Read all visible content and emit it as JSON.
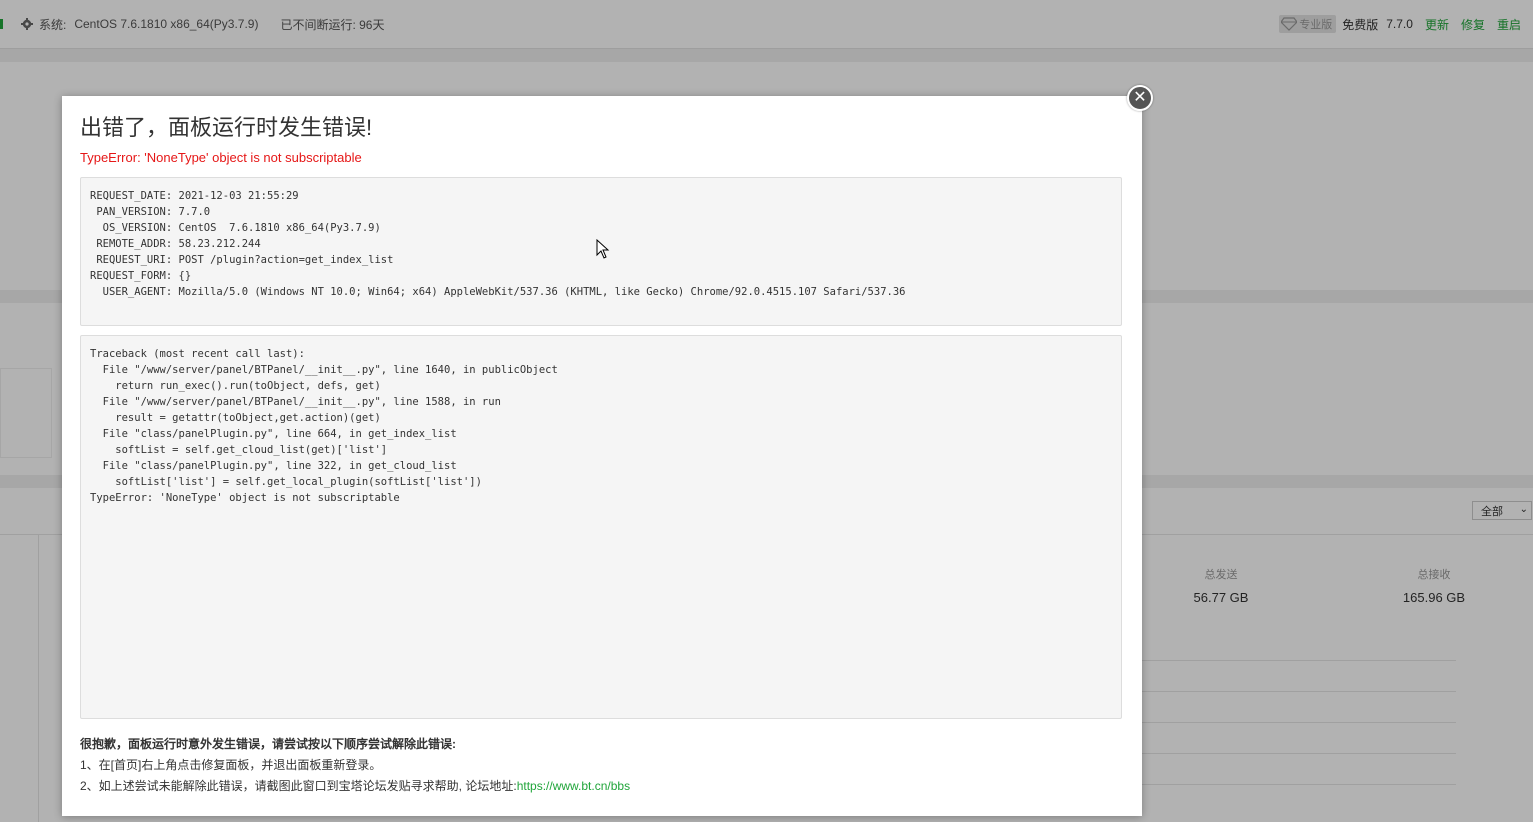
{
  "topbar": {
    "system_label": "系统:",
    "system_value": "CentOS 7.6.1810 x86_64(Py3.7.9)",
    "uptime": "已不间断运行: 96天",
    "pro_badge": "专业版",
    "free_label": "免费版",
    "version": "7.7.0",
    "update_link": "更新",
    "repair_link": "修复",
    "restart_link": "重启"
  },
  "background": {
    "filter_select": "全部",
    "stats": [
      {
        "label": "总发送",
        "value": "56.77 GB"
      },
      {
        "label": "总接收",
        "value": "165.96 GB"
      }
    ]
  },
  "modal": {
    "title": "出错了，面板运行时发生错误!",
    "error_type": "TypeError: 'NoneType' object is not subscriptable",
    "request_info": [
      "REQUEST_DATE: 2021-12-03 21:55:29",
      " PAN_VERSION: 7.7.0",
      "  OS_VERSION: CentOS  7.6.1810 x86_64(Py3.7.9)",
      " REMOTE_ADDR: 58.23.212.244",
      " REQUEST_URI: POST /plugin?action=get_index_list",
      "REQUEST_FORM: {}",
      "  USER_AGENT: Mozilla/5.0 (Windows NT 10.0; Win64; x64) AppleWebKit/537.36 (KHTML, like Gecko) Chrome/92.0.4515.107 Safari/537.36"
    ],
    "traceback": [
      "Traceback (most recent call last):",
      "  File \"/www/server/panel/BTPanel/__init__.py\", line 1640, in publicObject",
      "    return run_exec().run(toObject, defs, get)",
      "  File \"/www/server/panel/BTPanel/__init__.py\", line 1588, in run",
      "    result = getattr(toObject,get.action)(get)",
      "  File \"class/panelPlugin.py\", line 664, in get_index_list",
      "    softList = self.get_cloud_list(get)['list']",
      "  File \"class/panelPlugin.py\", line 322, in get_cloud_list",
      "    softList['list'] = self.get_local_plugin(softList['list'])",
      "TypeError: 'NoneType' object is not subscriptable"
    ],
    "help_title": "很抱歉，面板运行时意外发生错误，请尝试按以下顺序尝试解除此错误:",
    "help_step1": "1、在[首页]右上角点击修复面板，并退出面板重新登录。",
    "help_step2": "2、如上述尝试未能解除此错误，请截图此窗口到宝塔论坛发贴寻求帮助, 论坛地址:",
    "forum_url": "https://www.bt.cn/bbs"
  }
}
